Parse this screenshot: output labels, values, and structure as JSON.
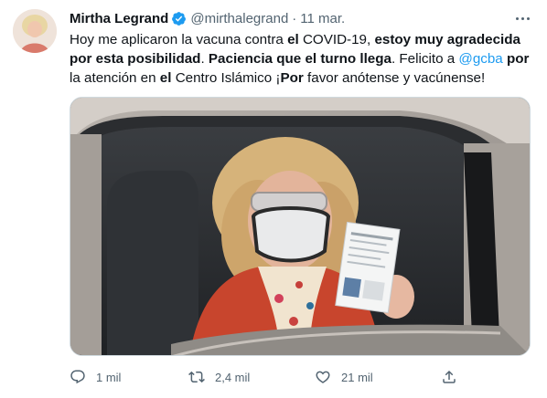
{
  "author": {
    "name": "Mirtha Legrand",
    "handle": "@mirthalegrand",
    "separator": "·",
    "date": "11 mar."
  },
  "tweet": {
    "segments": [
      {
        "text": "Hoy me aplicaron la vacuna contra ",
        "style": "normal"
      },
      {
        "text": "el",
        "style": "bold"
      },
      {
        "text": " COVID-19, ",
        "style": "normal"
      },
      {
        "text": "estoy muy agradecida por esta posibilidad",
        "style": "bold"
      },
      {
        "text": ". ",
        "style": "normal"
      },
      {
        "text": "Paciencia que el turno llega",
        "style": "bold"
      },
      {
        "text": ". Felicito a ",
        "style": "normal"
      },
      {
        "text": "@gcba",
        "style": "mention"
      },
      {
        "text": " ",
        "style": "normal"
      },
      {
        "text": "por",
        "style": "bold"
      },
      {
        "text": " la atención en ",
        "style": "normal"
      },
      {
        "text": "el",
        "style": "bold"
      },
      {
        "text": " Centro Islámico ¡",
        "style": "normal"
      },
      {
        "text": "Por",
        "style": "bold"
      },
      {
        "text": " favor anótense y vacúnense!",
        "style": "normal"
      }
    ]
  },
  "actions": {
    "reply": {
      "icon": "reply-icon",
      "count": "1 mil"
    },
    "retweet": {
      "icon": "retweet-icon",
      "count": "2,4 mil"
    },
    "like": {
      "icon": "heart-icon",
      "count": "21 mil"
    },
    "share": {
      "icon": "share-icon"
    }
  },
  "colors": {
    "text": "#0f1419",
    "secondary": "#536471",
    "accent": "#1d9bf0",
    "verified": "#1d9bf0"
  }
}
